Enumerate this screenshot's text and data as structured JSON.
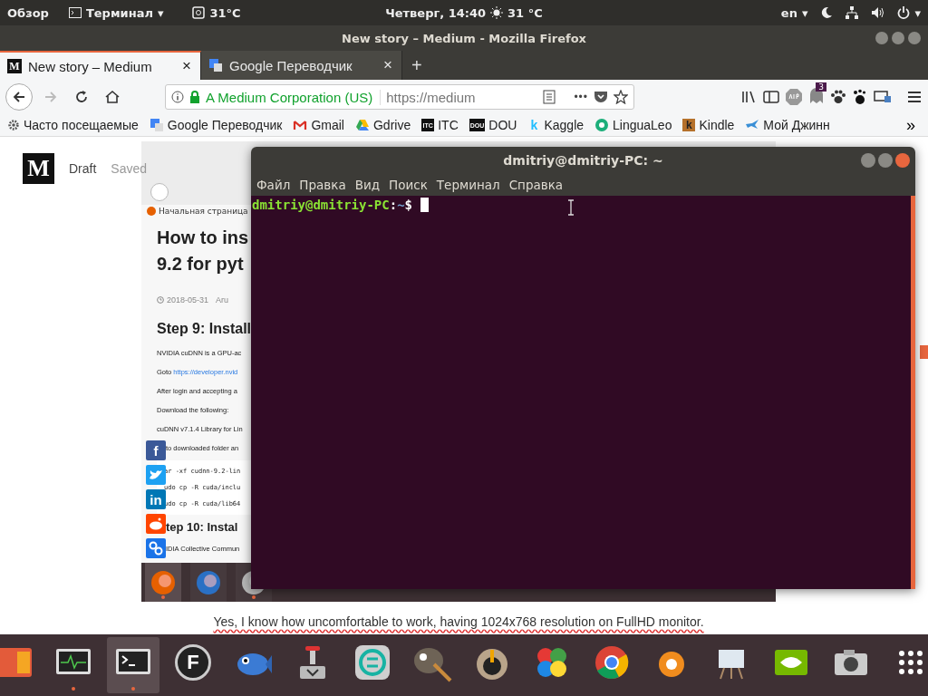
{
  "top_bar": {
    "activities": "Обзор",
    "app_menu": "Терминал",
    "app_caret": "▾",
    "weather": "31°C",
    "clock": "Четверг, 14:40",
    "clock_weather": "31 °C",
    "language": "en",
    "language_caret": "▾",
    "power_caret": "▾"
  },
  "window": {
    "title": "New story – Medium - Mozilla Firefox"
  },
  "tabs": [
    {
      "label": "New story – Medium",
      "favicon": "M",
      "selected": true,
      "close": "×"
    },
    {
      "label": "Google Переводчик",
      "selected": false,
      "close": "×"
    }
  ],
  "new_tab": "+",
  "nav": {
    "back": {
      "disabled": false
    },
    "forward": {
      "disabled": true
    }
  },
  "address_bar": {
    "identity": "A Medium Corporation (US)",
    "url": "https://medium",
    "more": "•••"
  },
  "extension_badge": "3",
  "bookmarks": [
    {
      "label": "Часто посещаемые",
      "kind": "gear"
    },
    {
      "label": "Google Переводчик",
      "kind": "translate"
    },
    {
      "label": "Gmail",
      "kind": "gmail"
    },
    {
      "label": "Gdrive",
      "kind": "drive"
    },
    {
      "label": "ITC",
      "kind": "itc",
      "glyph": "ITC"
    },
    {
      "label": "DOU",
      "kind": "dou",
      "glyph": "DOU"
    },
    {
      "label": "Kaggle",
      "kind": "kaggle",
      "glyph": "k"
    },
    {
      "label": "LinguaLeo",
      "kind": "leo"
    },
    {
      "label": "Kindle",
      "kind": "kindle",
      "glyph": "k"
    },
    {
      "label": "Мой Джинн",
      "kind": "bird"
    }
  ],
  "bookmarks_overflow": "»",
  "medium": {
    "logo": "M",
    "status": "Draft",
    "saved": "Saved"
  },
  "embedded_screenshot": {
    "bookmark": "Начальная страница",
    "heading": [
      "How to ins",
      "9.2 for pyt"
    ],
    "date": "2018-05-31",
    "author": "Aru",
    "step9": "Step 9: Install",
    "lines": [
      {
        "text": "NVIDIA cuDNN is a GPU-ac"
      },
      {
        "text": "Goto ",
        "link": "https://developer.nvid"
      },
      {
        "text": "After login and accepting a"
      },
      {
        "text": "Download the following:"
      },
      {
        "text": "cuDNN v7.1.4 Library for Lin"
      },
      {
        "text": "to downloaded folder an",
        "indent": true
      }
    ],
    "code": [
      "ar -xf cudnn-9.2-lin",
      "udo cp -R cuda/inclu",
      "udo cp -R cuda/lib64"
    ],
    "step10": "tep 10: Instal",
    "last_line": "IDIA Collective Commun",
    "share": [
      {
        "kind": "facebook",
        "glyph": "f"
      },
      {
        "kind": "twitter"
      },
      {
        "kind": "linkedin",
        "glyph": "in"
      },
      {
        "kind": "reddit"
      },
      {
        "kind": "link"
      }
    ],
    "mini_dock": [
      {
        "kind": "firefox",
        "selected": true,
        "running": true
      },
      {
        "kind": "thunderbird",
        "selected": false,
        "running": false
      },
      {
        "kind": "files",
        "selected": false,
        "running": true
      }
    ]
  },
  "caption": "Yes, I know how uncomfortable to work, having 1024x768 resolution on FullHD monitor.",
  "terminal": {
    "title": "dmitriy@dmitriy-PC: ~",
    "menu": [
      "Файл",
      "Правка",
      "Вид",
      "Поиск",
      "Терминал",
      "Справка"
    ],
    "user": "dmitriy@dmitriy-PC",
    "separator": ":",
    "path": "~",
    "sign": "$"
  },
  "dock": [
    {
      "kind": "partial",
      "running": false,
      "selected": false
    },
    {
      "kind": "monitor",
      "running": true,
      "selected": false
    },
    {
      "kind": "terminal",
      "running": true,
      "selected": true
    },
    {
      "kind": "reader",
      "glyph": "F",
      "running": false,
      "selected": false
    },
    {
      "kind": "fish",
      "running": false,
      "selected": false
    },
    {
      "kind": "installer",
      "running": false,
      "selected": false
    },
    {
      "kind": "sync",
      "running": false,
      "selected": false
    },
    {
      "kind": "gimp",
      "running": false,
      "selected": false
    },
    {
      "kind": "joystick",
      "running": false,
      "selected": false
    },
    {
      "kind": "flower",
      "running": false,
      "selected": false
    },
    {
      "kind": "chrome",
      "running": false,
      "selected": false
    },
    {
      "kind": "cone",
      "running": false,
      "selected": false
    },
    {
      "kind": "easel",
      "running": false,
      "selected": false
    },
    {
      "kind": "nvidia",
      "running": false,
      "selected": false
    },
    {
      "kind": "camera",
      "running": false,
      "selected": false
    },
    {
      "kind": "grid",
      "running": false,
      "selected": false
    }
  ]
}
